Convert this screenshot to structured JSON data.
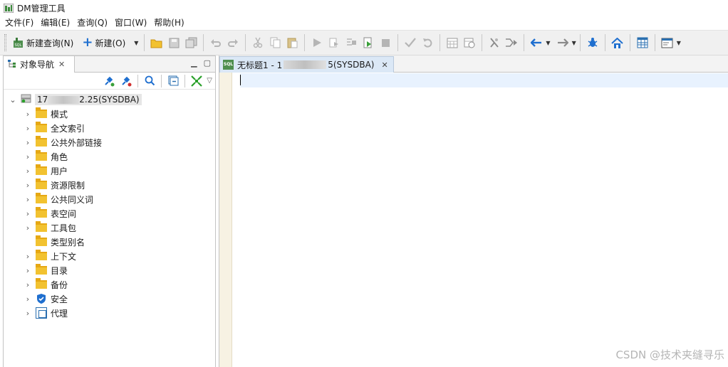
{
  "window": {
    "title": "DM管理工具"
  },
  "menu": [
    "文件(F)",
    "编辑(E)",
    "查询(Q)",
    "窗口(W)",
    "帮助(H)"
  ],
  "toolbar": {
    "new_query_label": "新建查询(N)",
    "new_label": "新建(O)"
  },
  "navigator": {
    "tab_label": "对象导航",
    "root_label_prefix": "17",
    "root_label_suffix": "2.25(SYSDBA)",
    "items": [
      {
        "label": "模式",
        "icon": "folder-icon",
        "expandable": true
      },
      {
        "label": "全文索引",
        "icon": "folder-icon",
        "expandable": true
      },
      {
        "label": "公共外部链接",
        "icon": "folder-icon",
        "expandable": true
      },
      {
        "label": "角色",
        "icon": "folder-icon",
        "expandable": true
      },
      {
        "label": "用户",
        "icon": "folder-icon",
        "expandable": true
      },
      {
        "label": "资源限制",
        "icon": "folder-icon",
        "expandable": true
      },
      {
        "label": "公共同义词",
        "icon": "folder-icon",
        "expandable": true
      },
      {
        "label": "表空间",
        "icon": "folder-icon",
        "expandable": true
      },
      {
        "label": "工具包",
        "icon": "folder-icon",
        "expandable": true
      },
      {
        "label": "类型别名",
        "icon": "folder-icon",
        "expandable": false
      },
      {
        "label": "上下文",
        "icon": "folder-icon",
        "expandable": true
      },
      {
        "label": "目录",
        "icon": "folder-icon",
        "expandable": true
      },
      {
        "label": "备份",
        "icon": "folder-icon",
        "expandable": true
      },
      {
        "label": "安全",
        "icon": "shield-icon",
        "expandable": true
      },
      {
        "label": "代理",
        "icon": "agent-icon",
        "expandable": true
      }
    ]
  },
  "editor": {
    "tab_prefix": "无标题1 - 1",
    "tab_suffix": "5(SYSDBA)"
  },
  "watermark": "CSDN @技术夹缝寻乐",
  "colors": {
    "folder": "#f2c230",
    "accent_blue": "#2a6fb0",
    "active_line": "#e8f2fe",
    "gutter": "#f7f2e3"
  }
}
